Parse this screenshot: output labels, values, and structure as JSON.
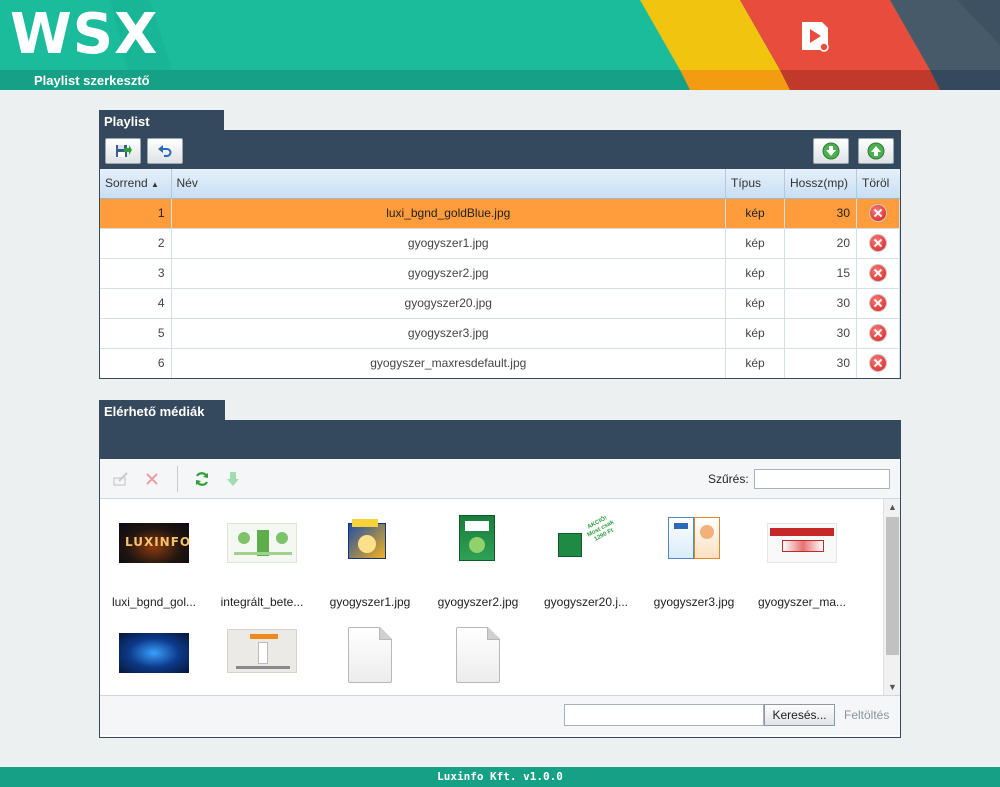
{
  "header": {
    "logo": "WSX",
    "subtitle": "Playlist szerkesztő",
    "colors": {
      "teal": "#1abc9c",
      "teal_dark": "#16a085",
      "yellow": "#f1c40f",
      "red": "#e74c3c",
      "slate": "#34495e"
    }
  },
  "playlist": {
    "tab_label": "Playlist",
    "toolbar": {
      "save_icon": "save-export-icon",
      "undo_icon": "undo-icon",
      "move_down_icon": "arrow-down-icon",
      "move_up_icon": "arrow-up-icon"
    },
    "columns": {
      "order": "Sorrend",
      "name": "Név",
      "type": "Típus",
      "length": "Hossz(mp)",
      "delete": "Töröl"
    },
    "rows": [
      {
        "order": "1",
        "name": "luxi_bgnd_goldBlue.jpg",
        "type": "kép",
        "length": "30"
      },
      {
        "order": "2",
        "name": "gyogyszer1.jpg",
        "type": "kép",
        "length": "20"
      },
      {
        "order": "3",
        "name": "gyogyszer2.jpg",
        "type": "kép",
        "length": "15"
      },
      {
        "order": "4",
        "name": "gyogyszer20.jpg",
        "type": "kép",
        "length": "30"
      },
      {
        "order": "5",
        "name": "gyogyszer3.jpg",
        "type": "kép",
        "length": "30"
      },
      {
        "order": "6",
        "name": "gyogyszer_maxresdefault.jpg",
        "type": "kép",
        "length": "30"
      }
    ],
    "selected_row": 1
  },
  "media": {
    "tab_label": "Elérhető médiák",
    "toolbar": {
      "edit_icon": "edit-icon",
      "delete_icon": "close-icon",
      "refresh_icon": "refresh-icon",
      "add_icon": "arrow-down-icon"
    },
    "filter_label": "Szűrés:",
    "filter_value": "",
    "items": [
      {
        "caption": "luxi_bgnd_gol...",
        "thumb": "luxinfo-thumbnail"
      },
      {
        "caption": "integrált_bete...",
        "thumb": "infographic-thumbnail"
      },
      {
        "caption": "gyogyszer1.jpg",
        "thumb": "neo-citran-box-thumbnail"
      },
      {
        "caption": "gyogyszer2.jpg",
        "thumb": "vicks-box-thumbnail"
      },
      {
        "caption": "gyogyszer20.j...",
        "thumb": "promo-thumbnail",
        "badge_text": "AKCIÓ! Most csak 1290 Ft"
      },
      {
        "caption": "gyogyszer3.jpg",
        "thumb": "box-thumbnail"
      },
      {
        "caption": "gyogyszer_ma...",
        "thumb": "product-banner-thumbnail"
      },
      {
        "caption": "",
        "thumb": "blue-tech-thumbnail"
      },
      {
        "caption": "",
        "thumb": "doctor-slide-thumbnail"
      },
      {
        "caption": "",
        "thumb": "generic-file-icon"
      },
      {
        "caption": "",
        "thumb": "generic-file-icon"
      }
    ],
    "search_value": "",
    "search_button": "Keresés...",
    "upload_label": "Feltöltés"
  },
  "footer": {
    "text": "Luxinfo Kft. v1.0.0"
  }
}
